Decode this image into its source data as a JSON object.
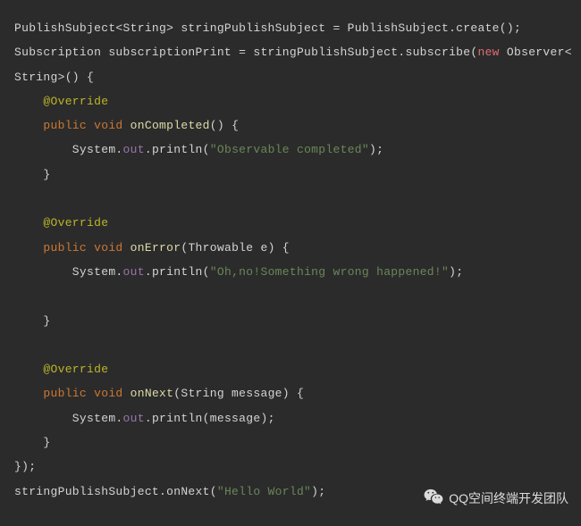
{
  "code": {
    "l1": {
      "a": "PublishSubject<String> stringPublishSubject = PublishSubject.create();"
    },
    "l2": {
      "a": "Subscription subscriptionPrint = stringPublishSubject.subscribe(",
      "b": "new",
      "c": " Observer<"
    },
    "l3": {
      "a": "String>() {"
    },
    "l4": {
      "a": "    ",
      "b": "@Override"
    },
    "l5": {
      "a": "    ",
      "b": "public",
      "c": " ",
      "d": "void",
      "e": " ",
      "f": "onCompleted",
      "g": "() {"
    },
    "l6": {
      "a": "        System.",
      "b": "out",
      "c": ".println(",
      "d": "\"Observable completed\"",
      "e": ");"
    },
    "l7": {
      "a": "    }"
    },
    "l8": {
      "a": ""
    },
    "l9": {
      "a": "    ",
      "b": "@Override"
    },
    "l10": {
      "a": "    ",
      "b": "public",
      "c": " ",
      "d": "void",
      "e": " ",
      "f": "onError",
      "g": "(Throwable e) {"
    },
    "l11": {
      "a": "        System.",
      "b": "out",
      "c": ".println(",
      "d": "\"Oh,no!Something wrong happened!\"",
      "e": ");"
    },
    "l12": {
      "a": ""
    },
    "l13": {
      "a": "    }"
    },
    "l14": {
      "a": ""
    },
    "l15": {
      "a": "    ",
      "b": "@Override"
    },
    "l16": {
      "a": "    ",
      "b": "public",
      "c": " ",
      "d": "void",
      "e": " ",
      "f": "onNext",
      "g": "(String message) {"
    },
    "l17": {
      "a": "        System.",
      "b": "out",
      "c": ".println(message);"
    },
    "l18": {
      "a": "    }"
    },
    "l19": {
      "a": "});"
    },
    "l20": {
      "a": "stringPublishSubject.onNext(",
      "b": "\"Hello World\"",
      "c": ");"
    }
  },
  "watermark": {
    "label": "QQ空间终端开发团队"
  }
}
